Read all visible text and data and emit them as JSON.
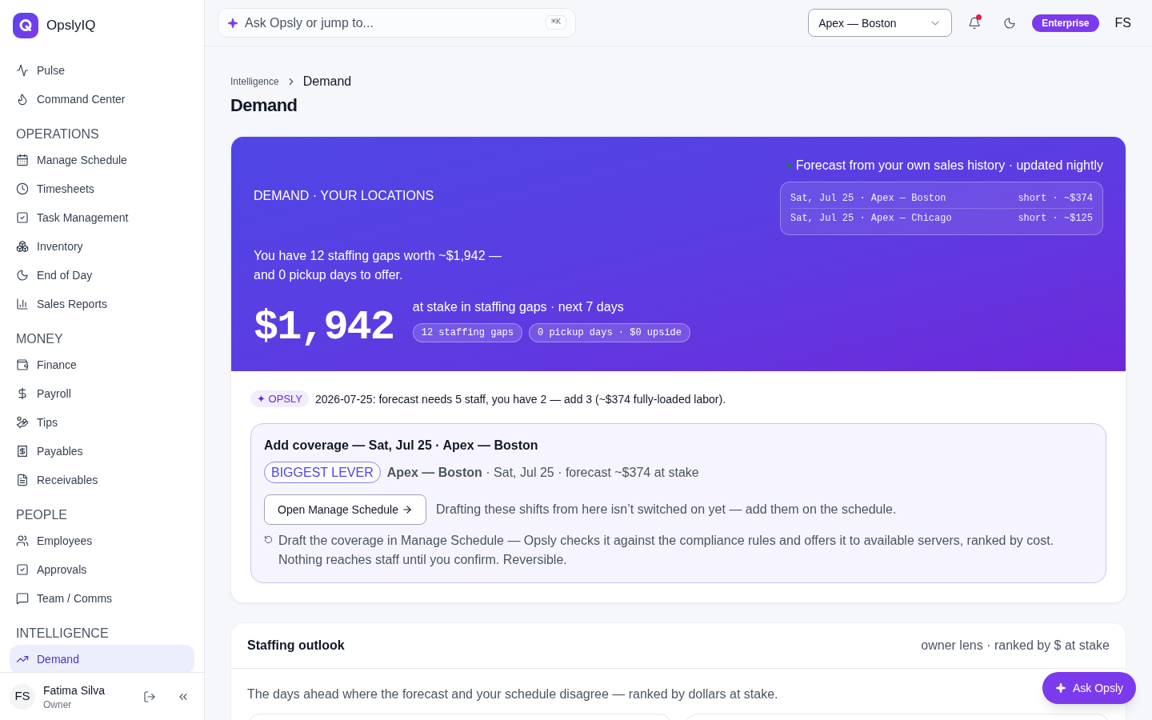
{
  "sidebar": {
    "brand": "OpslyIQ",
    "top_items": [
      {
        "label": "Pulse",
        "selected": false
      },
      {
        "label": "Command Center",
        "selected": false
      }
    ],
    "sections": [
      {
        "heading": "OPERATIONS",
        "items": [
          {
            "label": "Manage Schedule",
            "selected": false
          },
          {
            "label": "Timesheets",
            "selected": false
          },
          {
            "label": "Task Management",
            "selected": false
          },
          {
            "label": "Inventory",
            "selected": false
          },
          {
            "label": "End of Day",
            "selected": false
          },
          {
            "label": "Sales Reports",
            "selected": false
          }
        ]
      },
      {
        "heading": "MONEY",
        "items": [
          {
            "label": "Finance",
            "selected": false
          },
          {
            "label": "Payroll",
            "selected": false
          },
          {
            "label": "Tips",
            "selected": false
          },
          {
            "label": "Payables",
            "selected": false
          },
          {
            "label": "Receivables",
            "selected": false
          }
        ]
      },
      {
        "heading": "PEOPLE",
        "items": [
          {
            "label": "Employees",
            "selected": false
          },
          {
            "label": "Approvals",
            "selected": false
          },
          {
            "label": "Team / Comms",
            "selected": false
          }
        ]
      },
      {
        "heading": "INTELLIGENCE",
        "items": [
          {
            "label": "Demand",
            "selected": true
          }
        ]
      }
    ],
    "user": {
      "initials": "FS",
      "name": "Fatima Silva",
      "role": "Owner"
    }
  },
  "topbar": {
    "search": {
      "placeholder": "Ask Opsly or jump to...",
      "shortcut": "⌘K"
    },
    "location": {
      "value": "Apex — Boston"
    },
    "notifications": {
      "unread": true
    },
    "plan": "Enterprise",
    "user_initials": "FS"
  },
  "page": {
    "breadcrumb": [
      {
        "label": "Intelligence"
      },
      {
        "label": "Demand"
      }
    ],
    "title": "Demand"
  },
  "hero": {
    "eyebrow": "DEMAND · YOUR LOCATIONS",
    "forecast_note": "Forecast from your own sales history · updated nightly",
    "forecast_rows": [
      {
        "label": "Sat, Jul 25 · Apex — Boston",
        "value": "short · ~$374"
      },
      {
        "label": "Sat, Jul 25 · Apex — Chicago",
        "value": "short · ~$125"
      }
    ],
    "summary": "You have 12 staffing gaps worth ~$1,942 — and 0 pickup days to offer.",
    "figure": "$1,942",
    "figure_caption": "at stake in staffing gaps · next 7 days",
    "pills": [
      "12 staffing gaps",
      "0 pickup days · $0 upside"
    ]
  },
  "insight": {
    "badge": "✦ OPSLY",
    "text": "2026-07-25: forecast needs 5 staff, you have 2 — add 3 (~$374 fully-loaded labor)."
  },
  "action": {
    "title": "Add coverage — Sat, Jul 25 · Apex — Boston",
    "tag": "BIGGEST LEVER",
    "summary": "**Apex — Boston** · Sat, Jul 25 · forecast ~$374 at stake",
    "button": "Open Manage Schedule",
    "note": "Drafting these shifts from here isn’t switched on yet — add them on the schedule.",
    "explanation": "Draft the coverage in Manage Schedule — Opsly checks it against the compliance rules and offers it to available servers, ranked by cost. Nothing reaches staff until you confirm. Reversible."
  },
  "outlook": {
    "title": "Staffing outlook",
    "lens": "owner lens · ranked by $ at stake",
    "description": "The days ahead where the forecast and your schedule disagree — ranked by dollars at stake."
  },
  "assistant_button": {
    "label": "Ask Opsly"
  }
}
